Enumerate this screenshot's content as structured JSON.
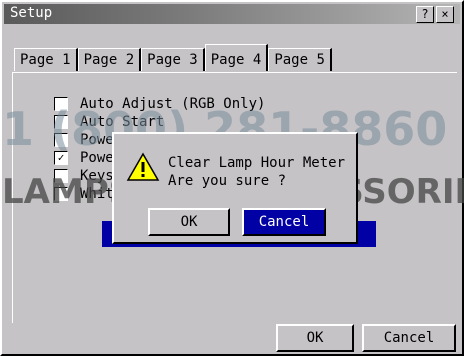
{
  "window": {
    "title": "Setup",
    "help_button": "?",
    "close_button": "×"
  },
  "tabs": [
    {
      "label": "Page 1"
    },
    {
      "label": "Page 2"
    },
    {
      "label": "Page 3"
    },
    {
      "label": "Page 4"
    },
    {
      "label": "Page 5"
    }
  ],
  "options": [
    {
      "label": "Auto Adjust (RGB Only)",
      "checked": false
    },
    {
      "label": "Auto Start",
      "checked": false
    },
    {
      "label": "Powe",
      "checked": false
    },
    {
      "label": "Powe",
      "checked": true
    },
    {
      "label": "Keys",
      "checked": false
    },
    {
      "label": "Whit",
      "checked": false
    }
  ],
  "dialog": {
    "line1": "Clear Lamp Hour Meter",
    "line2": "Are you sure ?",
    "ok_label": "OK",
    "cancel_label": "Cancel"
  },
  "footer": {
    "ok_label": "OK",
    "cancel_label": "Cancel"
  },
  "watermark": {
    "line1": "1 (800) 281-8860",
    "line2": "LAMPS AND ACCESSORIES"
  }
}
